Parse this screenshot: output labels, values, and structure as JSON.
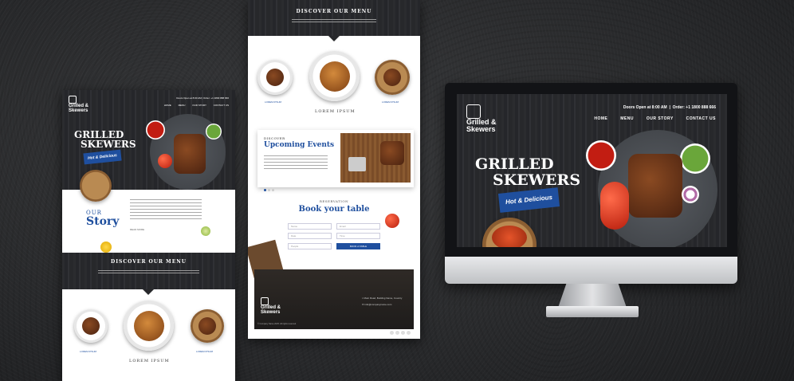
{
  "brand": {
    "name_line1": "Grilled &",
    "name_line2": "Skewers",
    "accent": "#1f4f9e"
  },
  "nav": [
    "HOME",
    "MENU",
    "OUR STORY",
    "CONTACT US"
  ],
  "topbar": {
    "doors": "Doors Open at 8:00 AM",
    "order": "Order: +1 1800 888 666"
  },
  "hero": {
    "line1": "GRILLED",
    "line2": "SKEWERS",
    "script": "Hot & Delicious"
  },
  "story": {
    "kicker": "OUR",
    "title": "Story",
    "read_more": "READ MORE"
  },
  "menu": {
    "section_title": "DISCOVER OUR MENU",
    "items": [
      "LOREM IPSUM",
      "LOREM IPSUM",
      "LOREM IPSUM"
    ]
  },
  "events": {
    "kicker": "DISCOVER",
    "title": "Upcoming Events"
  },
  "reservation": {
    "kicker": "RESERVATION",
    "title": "Book your table",
    "fields": [
      "Name",
      "Email",
      "Date",
      "Time",
      "People"
    ],
    "button": "BOOK A TABLE"
  },
  "footer": {
    "address": "Main Road, Building Name, Country",
    "email": "info@companyname.com",
    "copyright": "© Company Name 2025. All rights reserved."
  },
  "colors": {
    "blue": "#1f4f9e",
    "dark": "#1e1f22",
    "white": "#ffffff"
  }
}
